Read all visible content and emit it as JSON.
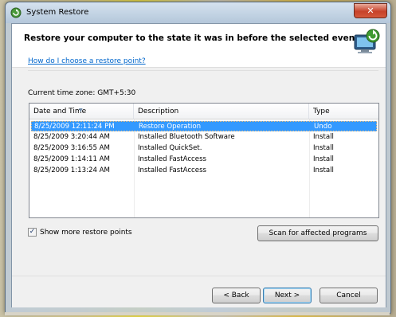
{
  "window": {
    "title": "System Restore",
    "close_symbol": "✕",
    "icon": "system-restore-icon"
  },
  "header": {
    "heading": "Restore your computer to the state it was in before the selected event",
    "image": "system-restore-computer-icon"
  },
  "help_link": "How do I choose a restore point?",
  "timezone": "Current time zone: GMT+5:30",
  "list": {
    "columns": [
      "Date and Time",
      "Description",
      "Type"
    ],
    "rows": [
      {
        "date": "8/25/2009 12:11:24 PM",
        "description": "Restore Operation",
        "type": "Undo",
        "selected": true
      },
      {
        "date": "8/25/2009 3:20:44 AM",
        "description": "Installed Bluetooth Software",
        "type": "Install"
      },
      {
        "date": "8/25/2009 3:16:55 AM",
        "description": "Installed QuickSet.",
        "type": "Install"
      },
      {
        "date": "8/25/2009 1:14:11 AM",
        "description": "Installed FastAccess",
        "type": "Install"
      },
      {
        "date": "8/25/2009 1:13:24 AM",
        "description": "Installed FastAccess",
        "type": "Install"
      }
    ]
  },
  "show_more": {
    "label": "Show more restore points",
    "checked": true,
    "check_symbol": "✓"
  },
  "buttons": {
    "scan": "Scan for affected programs",
    "back": "< Back",
    "next": "Next >",
    "cancel": "Cancel"
  },
  "colors": {
    "selection": "#3399ff",
    "link": "#0066cc",
    "close": "#c7422a"
  }
}
